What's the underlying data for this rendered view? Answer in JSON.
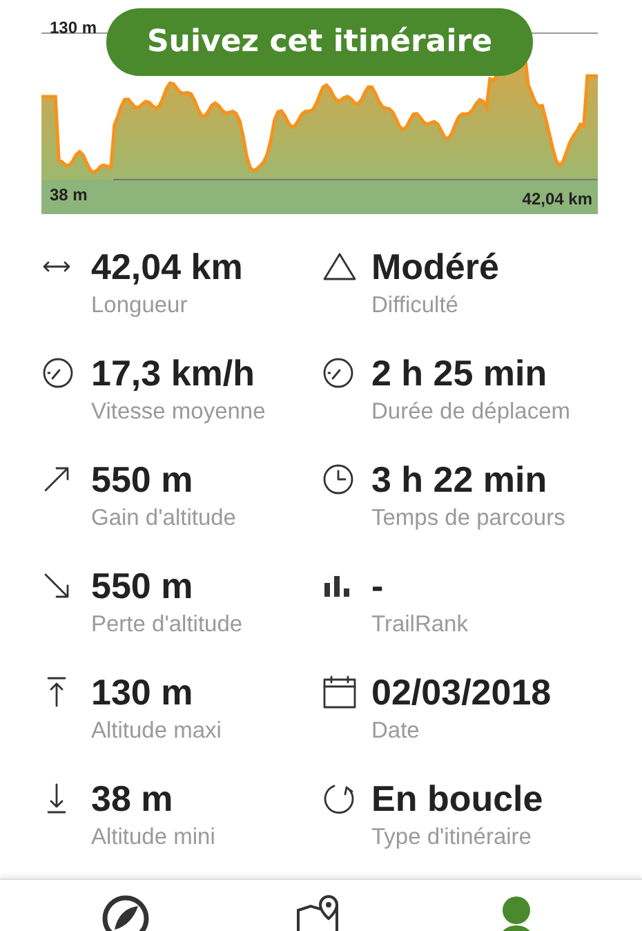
{
  "elevation_profile": {
    "max_label": "130 m",
    "min_label": "38 m",
    "distance_label": "42,04 km"
  },
  "follow_button": {
    "label": "Suivez cet itinéraire"
  },
  "stats": [
    {
      "value": "42,04 km",
      "label": "Longueur"
    },
    {
      "value": "Modéré",
      "label": "Difficulté"
    },
    {
      "value": "17,3 km/h",
      "label": "Vitesse moyenne"
    },
    {
      "value": "2 h 25 min",
      "label": "Durée de déplacem"
    },
    {
      "value": "550 m",
      "label": "Gain d'altitude"
    },
    {
      "value": "3 h 22 min",
      "label": "Temps de parcours"
    },
    {
      "value": "550 m",
      "label": "Perte d'altitude"
    },
    {
      "value": "-",
      "label": "TrailRank"
    },
    {
      "value": "130 m",
      "label": "Altitude maxi"
    },
    {
      "value": "02/03/2018",
      "label": "Date"
    },
    {
      "value": "38 m",
      "label": "Altitude mini"
    },
    {
      "value": "En boucle",
      "label": "Type d'itinéraire"
    }
  ],
  "bottom_nav": [
    {
      "selected": false
    },
    {
      "selected": false
    },
    {
      "selected": true
    }
  ]
}
